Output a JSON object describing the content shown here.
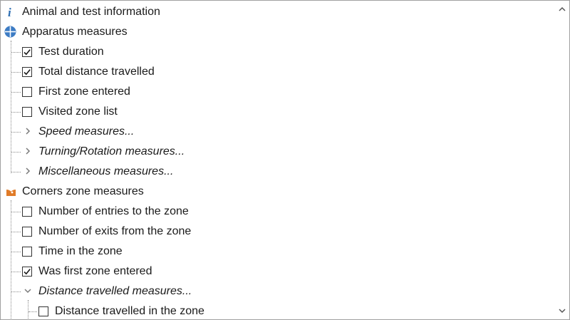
{
  "tree": {
    "items": [
      {
        "label": "Animal and test information",
        "icon": "info-icon",
        "italic": false
      },
      {
        "label": "Apparatus measures",
        "icon": "apparatus-icon",
        "italic": false
      },
      {
        "label": "Test duration",
        "checked": true
      },
      {
        "label": "Total distance travelled",
        "checked": true
      },
      {
        "label": "First zone entered",
        "checked": false
      },
      {
        "label": "Visited zone list",
        "checked": false
      },
      {
        "label": "Speed measures...",
        "expander": "collapsed"
      },
      {
        "label": "Turning/Rotation measures...",
        "expander": "collapsed"
      },
      {
        "label": "Miscellaneous measures...",
        "expander": "collapsed"
      },
      {
        "label": "Corners zone measures",
        "icon": "corner-zone-icon"
      },
      {
        "label": "Number of entries to the zone",
        "checked": false
      },
      {
        "label": "Number of exits from the zone",
        "checked": false
      },
      {
        "label": "Time in the zone",
        "checked": false
      },
      {
        "label": "Was first zone entered",
        "checked": true
      },
      {
        "label": "Distance travelled measures...",
        "expander": "expanded"
      },
      {
        "label": "Distance travelled in the zone",
        "checked": false
      }
    ]
  },
  "colors": {
    "info_icon": "#2e6fb3",
    "apparatus_icon": "#3d7cc4",
    "corner_icon": "#e07b28",
    "checkmark": "#1a1a1a"
  }
}
